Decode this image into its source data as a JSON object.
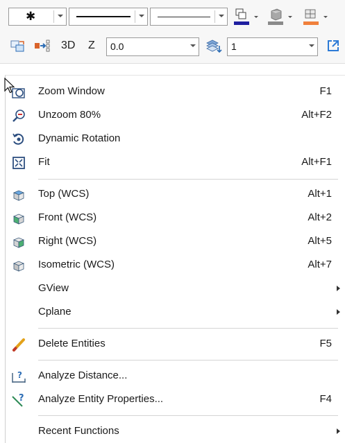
{
  "toolbar": {
    "point_style": "✱",
    "z_label": "Z",
    "z_value": "0.0",
    "view3d_label": "3D",
    "level_value": "1",
    "colors": {
      "line": "#1f1fa0",
      "surface": "#8a8a8a",
      "solid": "#f0803c"
    }
  },
  "menu": {
    "zoom_window": {
      "label": "Zoom Window",
      "shortcut": "F1"
    },
    "unzoom": {
      "label": "Unzoom 80%",
      "shortcut": "Alt+F2"
    },
    "dynamic_rotation": {
      "label": "Dynamic Rotation"
    },
    "fit": {
      "label": "Fit",
      "shortcut": "Alt+F1"
    },
    "top": {
      "label": "Top (WCS)",
      "shortcut": "Alt+1"
    },
    "front": {
      "label": "Front (WCS)",
      "shortcut": "Alt+2"
    },
    "right": {
      "label": "Right (WCS)",
      "shortcut": "Alt+5"
    },
    "isometric": {
      "label": "Isometric (WCS)",
      "shortcut": "Alt+7"
    },
    "gview": {
      "label": "GView"
    },
    "cplane": {
      "label": "Cplane"
    },
    "delete_entities": {
      "label": "Delete Entities",
      "shortcut": "F5"
    },
    "analyze_distance": {
      "label": "Analyze Distance..."
    },
    "analyze_entity": {
      "label": "Analyze Entity Properties...",
      "shortcut": "F4"
    },
    "recent_functions": {
      "label": "Recent Functions"
    }
  }
}
